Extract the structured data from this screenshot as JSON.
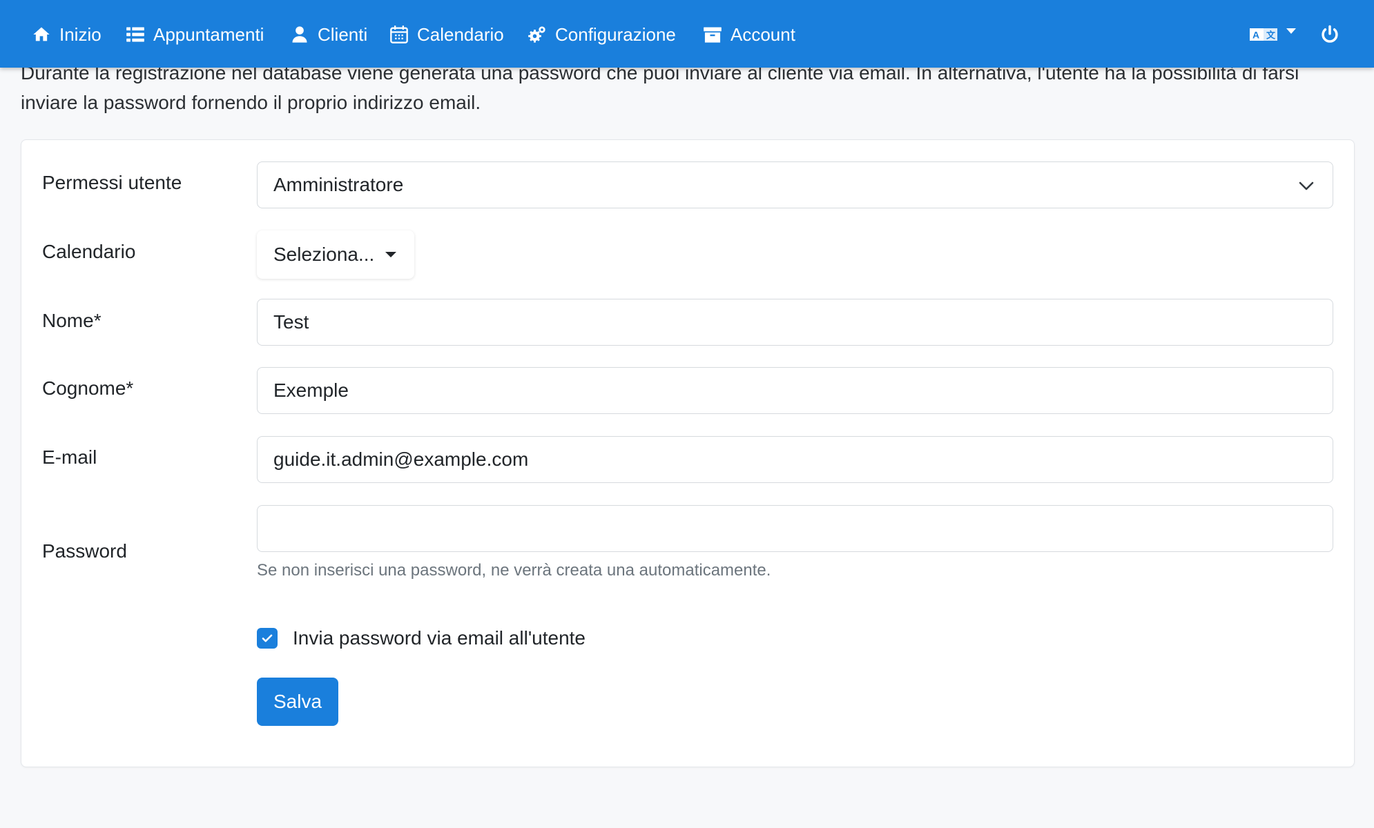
{
  "intro": {
    "text": "Durante la registrazione nel database viene generata una password che puoi inviare al cliente via email. In alternativa, l'utente ha la possibilità di farsi inviare la password fornendo il proprio indirizzo email."
  },
  "navbar": {
    "background": "#1a7fdc",
    "items": [
      {
        "label": "Inizio",
        "icon": "home-icon"
      },
      {
        "label": "Appuntamenti",
        "icon": "list-icon"
      },
      {
        "label": "Clienti",
        "icon": "user-icon"
      },
      {
        "label": "Calendario",
        "icon": "calendar-icon"
      },
      {
        "label": "Configurazione",
        "icon": "cogs-icon"
      },
      {
        "label": "Account",
        "icon": "archive-icon"
      }
    ],
    "right": {
      "language_icon": "language-icon",
      "logout_icon": "power-icon"
    }
  },
  "form": {
    "permissions": {
      "label": "Permessi utente",
      "value": "Amministratore"
    },
    "calendar": {
      "label": "Calendario",
      "value": "Seleziona..."
    },
    "first_name": {
      "label": "Nome*",
      "value": "Test"
    },
    "last_name": {
      "label": "Cognome*",
      "value": "Exemple"
    },
    "email": {
      "label": "E-mail",
      "value": "guide.it.admin@example.com"
    },
    "password": {
      "label": "Password",
      "value": "",
      "help": "Se non inserisci una password, ne verrà creata una automaticamente."
    },
    "send_password": {
      "label": "Invia password via email all'utente",
      "checked": true
    },
    "save_label": "Salva"
  }
}
